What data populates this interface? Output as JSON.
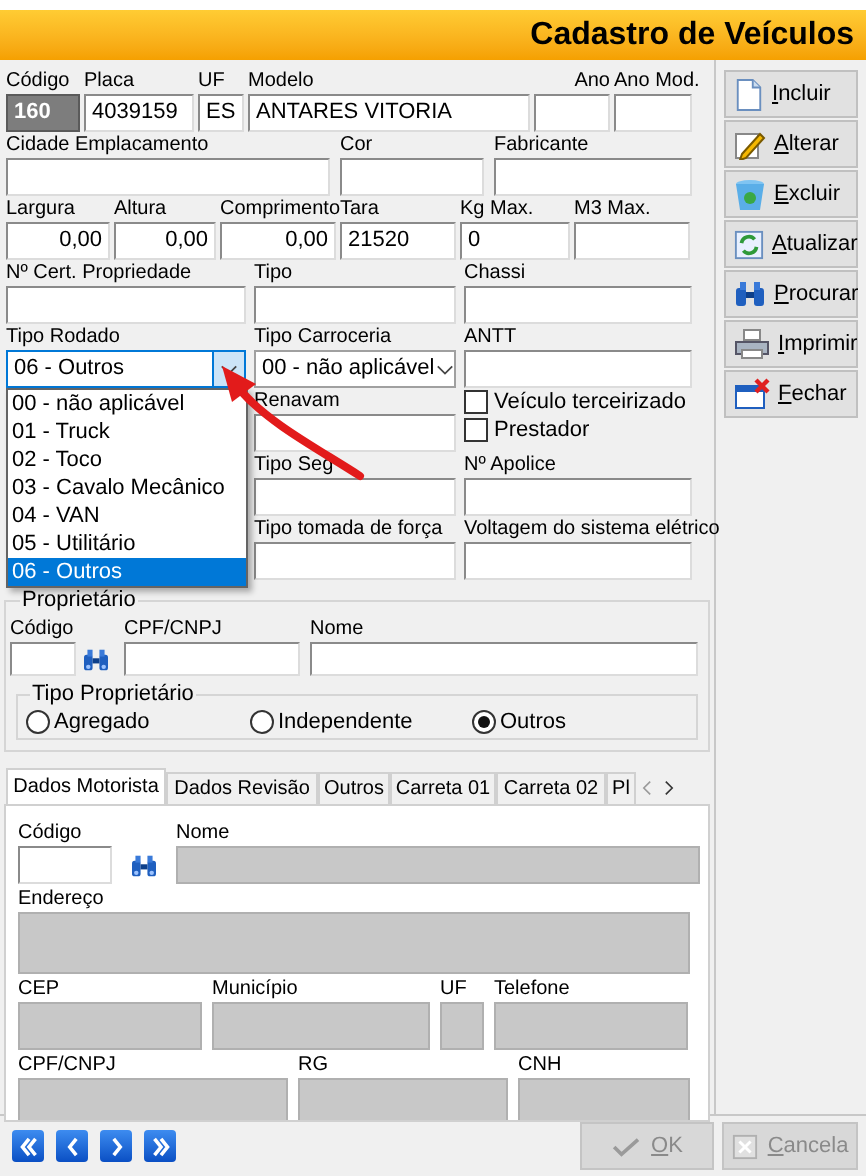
{
  "window": {
    "title": "Cadastro de Veículos"
  },
  "vehicle_rows": [
    [
      {
        "kind": "key",
        "label": "Código",
        "value": "160"
      },
      {
        "kind": "text",
        "label": "Placa",
        "value": "4039159"
      },
      {
        "kind": "text",
        "label": "UF",
        "value": "ES"
      },
      {
        "kind": "text",
        "label": "Modelo",
        "value": "ANTARES VITORIA"
      },
      {
        "kind": "text",
        "label": "Ano"
      },
      {
        "kind": "text",
        "label": "Ano Mod."
      }
    ],
    [
      {
        "kind": "text",
        "label": "Cidade Emplacamento"
      },
      {
        "kind": "text",
        "label": "Cor"
      },
      {
        "kind": "text",
        "label": "Fabricante"
      }
    ],
    [
      {
        "kind": "number",
        "label": "Largura",
        "value": "0,00"
      },
      {
        "kind": "number",
        "label": "Altura",
        "value": "0,00"
      },
      {
        "kind": "number",
        "label": "Comprimento",
        "value": "0,00"
      },
      {
        "kind": "text",
        "label": "Tara",
        "value": "21520"
      },
      {
        "kind": "text",
        "label": "Kg Max.",
        "value": "0"
      },
      {
        "kind": "text",
        "label": "M3 Max."
      }
    ],
    [
      {
        "kind": "text",
        "label": "Nº Cert. Propriedade"
      },
      {
        "kind": "text",
        "label": "Tipo"
      },
      {
        "kind": "text",
        "label": "Chassi"
      }
    ],
    [
      {
        "kind": "select",
        "label": "Tipo Rodado",
        "value": "06 - Outros",
        "expanded": true,
        "options": [
          {
            "label": "00 - não aplicável",
            "selected": false
          },
          {
            "label": "01 - Truck",
            "selected": false
          },
          {
            "label": "02 - Toco",
            "selected": false
          },
          {
            "label": "03 - Cavalo Mecânico",
            "selected": false
          },
          {
            "label": "04 - VAN",
            "selected": false
          },
          {
            "label": "05 - Utilitário",
            "selected": false
          },
          {
            "label": "06 - Outros",
            "selected": true
          }
        ]
      },
      {
        "kind": "select",
        "label": "Tipo Carroceria",
        "value": "00 - não aplicável",
        "expanded": false
      },
      {
        "kind": "text",
        "label": "ANTT"
      }
    ],
    [
      {
        "kind": "text",
        "label": "Renavam"
      },
      {
        "kind": "checks",
        "items": [
          {
            "label": "Veículo terceirizado",
            "checked": false
          },
          {
            "label": "Prestador",
            "checked": false
          }
        ]
      }
    ],
    [
      {
        "kind": "text",
        "label": "Tipo Seg"
      },
      {
        "kind": "text",
        "label": "Nº Apolice"
      }
    ],
    [
      {
        "kind": "text",
        "label": "Tipo tomada de força"
      },
      {
        "kind": "text",
        "label": "Voltagem do sistema elétrico"
      }
    ]
  ],
  "owner": {
    "title": "Proprietário",
    "fields": [
      {
        "label": "Código",
        "search": true
      },
      {
        "label": "CPF/CNPJ",
        "search": false
      },
      {
        "label": "Nome",
        "search": false
      }
    ],
    "type_group": {
      "title": "Tipo Proprietário",
      "options": [
        {
          "label": "Agregado",
          "selected": false
        },
        {
          "label": "Independente",
          "selected": false
        },
        {
          "label": "Outros",
          "selected": true
        }
      ]
    }
  },
  "tabs": [
    {
      "label": "Dados Motorista",
      "selected": true
    },
    {
      "label": "Dados Revisão",
      "selected": false
    },
    {
      "label": "Outros",
      "selected": false
    },
    {
      "label": "Carreta 01",
      "selected": false
    },
    {
      "label": "Carreta 02",
      "selected": false
    },
    {
      "label": "Pl",
      "selected": false
    }
  ],
  "driver_rows": [
    [
      {
        "label": "Código",
        "disabled": false,
        "search": true
      },
      {
        "label": "Nome",
        "disabled": true,
        "search": false
      }
    ],
    [
      {
        "label": "Endereço",
        "disabled": true,
        "search": false
      }
    ],
    [
      {
        "label": "CEP",
        "disabled": true,
        "search": false
      },
      {
        "label": "Município",
        "disabled": true,
        "search": false
      },
      {
        "label": "UF",
        "disabled": true,
        "search": false
      },
      {
        "label": "Telefone",
        "disabled": true,
        "search": false
      }
    ],
    [
      {
        "label": "CPF/CNPJ",
        "disabled": true,
        "search": false
      },
      {
        "label": "RG",
        "disabled": true,
        "search": false
      },
      {
        "label": "CNH",
        "disabled": true,
        "search": false
      }
    ]
  ],
  "side_buttons": [
    {
      "label": "Incluir"
    },
    {
      "label": "Alterar"
    },
    {
      "label": "Excluir"
    },
    {
      "label": "Atualizar"
    },
    {
      "label": "Procurar"
    },
    {
      "label": "Imprimir"
    },
    {
      "label": "Fechar"
    }
  ],
  "footer_buttons": [
    {
      "label": "OK",
      "disabled": true
    },
    {
      "label": "Cancela",
      "disabled": true
    }
  ]
}
